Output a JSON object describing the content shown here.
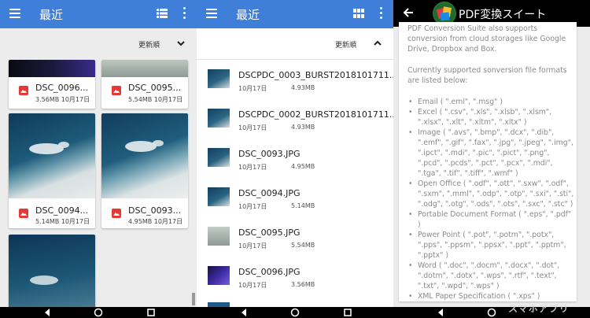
{
  "panel_left": {
    "title": "最近",
    "sort_label": "更新順",
    "cards": [
      {
        "name": "DSC_0096...",
        "meta": "3.56MB  10月17日"
      },
      {
        "name": "DSC_0095...",
        "meta": "5.54MB  10月17日"
      },
      {
        "name": "DSC_0094...",
        "meta": "5.14MB  10月17日"
      },
      {
        "name": "DSC_0093...",
        "meta": "4.95MB  10月17日"
      }
    ]
  },
  "panel_middle": {
    "title": "最近",
    "sort_label": "更新順",
    "files": [
      {
        "name": "DSCPDC_0003_BURST2018101711...",
        "date": "10月17日",
        "size": "4.93MB"
      },
      {
        "name": "DSCPDC_0002_BURST2018101711...",
        "date": "10月17日",
        "size": "4.93MB"
      },
      {
        "name": "DSC_0093.JPG",
        "date": "10月17日",
        "size": "4.95MB"
      },
      {
        "name": "DSC_0094.JPG",
        "date": "10月17日",
        "size": "5.14MB"
      },
      {
        "name": "DSC_0095.JPG",
        "date": "10月17日",
        "size": "5.54MB"
      },
      {
        "name": "DSC_0096.JPG",
        "date": "10月17日",
        "size": "3.56MB"
      }
    ]
  },
  "panel_right": {
    "title": "PDF変換スイート",
    "intro": "PDF Conversion Suite also supports conversion from cloud storages like Google Drive, Dropbox and Box.",
    "supported_heading": "Currently supported sonversion file formats are listed below:",
    "formats": [
      "Email ( \".eml\", \".msg\" )",
      "Excel ( \".csv\", \".xls\", \".xlsb\", \".xlsm\", \".xlsx\", \".xlt\", \".xltm\", \".xltx\" )",
      "Image ( \".avs\", \".bmp\", \".dcx\", \".dib\", \".emf\", \".gif\", \".fax\", \".jpg\", \".jpeg\", \".img\", \".ipct\", \".mdi\", \".pic\", \".pict\", \".png\", \".pcd\", \".pcds\", \".pct\", \".pcx\", \".mdi\", \".tga\", \".tif\", \".tiff\", \".wmf\" )",
      "Open Office ( \".odf\", \".ott\", \".sxw\", \".odf\", \".sxm\", \".mml\", \".odp\", \".otp\", \".sxi\", \".sti\", \".odg\", \".otg\", \".ods\", \".ots\", \".sxc\", \".stc\" )",
      "Portable Document Format ( \".eps\", \".pdf\" )",
      "Power Point ( \".pot\", \".potm\", \".potx\", \".pps\", \".ppsm\", \".ppsx\", \".ppt\", \".pptm\", \".pptx\" )",
      "Word ( \".doc\", \".docm\", \".docx\", \".dot\", \".dotm\", \".dotx\", \".wps\", \".rtf\", \".text\", \".txt\", \".wpd\", \".wps\" )",
      "XML Paper Specification ( \".xps\" )"
    ]
  },
  "watermark": "スマホアプリ",
  "colors": {
    "appbar": "#3f7ed9",
    "doc_text": "#8a8a8a",
    "image_badge": "#e53935"
  },
  "icons": {
    "menu": "menu-icon",
    "grid_view": "grid-view-icon",
    "list_view": "list-view-icon",
    "more": "more-vert-icon",
    "sort_down": "chevron-down-icon",
    "sort_up": "chevron-up-icon",
    "back": "arrow-back-icon",
    "image": "image-file-icon"
  }
}
